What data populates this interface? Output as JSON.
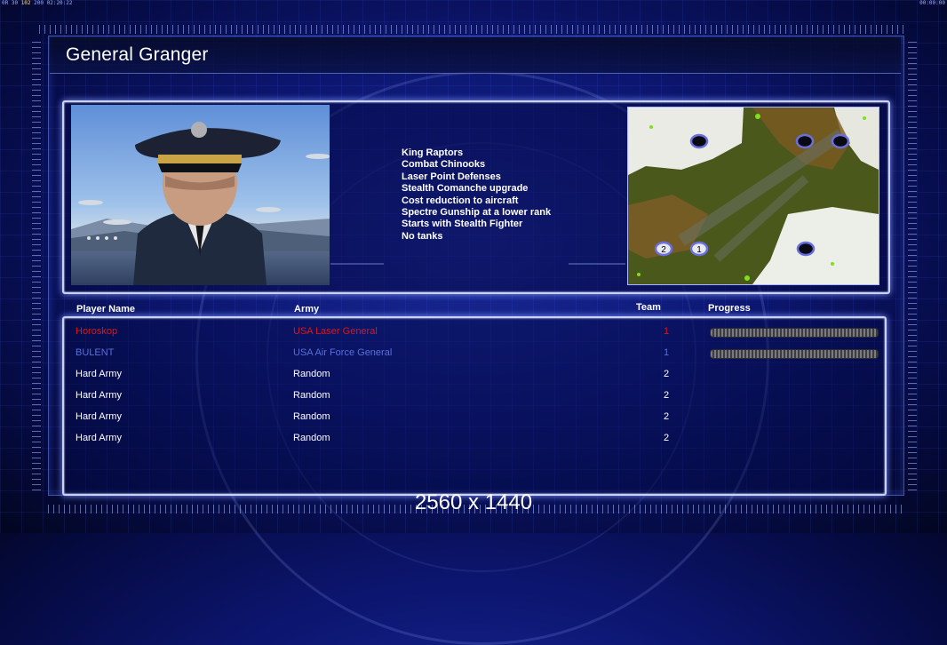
{
  "status": {
    "stats_prefix": "0R 30",
    "stats_highlight": "102",
    "stats_suffix": "200 02:20:22",
    "clock": "00:00:00"
  },
  "general": {
    "name": "General Granger",
    "features": [
      "King Raptors",
      "Combat Chinooks",
      "Laser Point Defenses",
      "Stealth Comanche upgrade",
      "Cost reduction to aircraft",
      "Spectre Gunship at a lower rank",
      "Starts with Stealth Fighter",
      "No tanks"
    ]
  },
  "minimap": {
    "start_labels": [
      "2",
      "1"
    ]
  },
  "table": {
    "headers": {
      "player": "Player Name",
      "army": "Army",
      "team": "Team",
      "progress": "Progress"
    },
    "rows": [
      {
        "name": "Horoskop",
        "army": "USA Laser General",
        "team": "1",
        "color": "#e01515",
        "progress": 1.0
      },
      {
        "name": "BULENT",
        "army": "USA Air Force General",
        "team": "1",
        "color": "#5b6fd6",
        "progress": 1.0
      },
      {
        "name": "Hard Army",
        "army": "Random",
        "team": "2",
        "color": "#ffffff"
      },
      {
        "name": "Hard Army",
        "army": "Random",
        "team": "2",
        "color": "#ffffff"
      },
      {
        "name": "Hard Army",
        "army": "Random",
        "team": "2",
        "color": "#ffffff"
      },
      {
        "name": "Hard Army",
        "army": "Random",
        "team": "2",
        "color": "#ffffff"
      }
    ]
  },
  "resolution": "2560 x 1440"
}
